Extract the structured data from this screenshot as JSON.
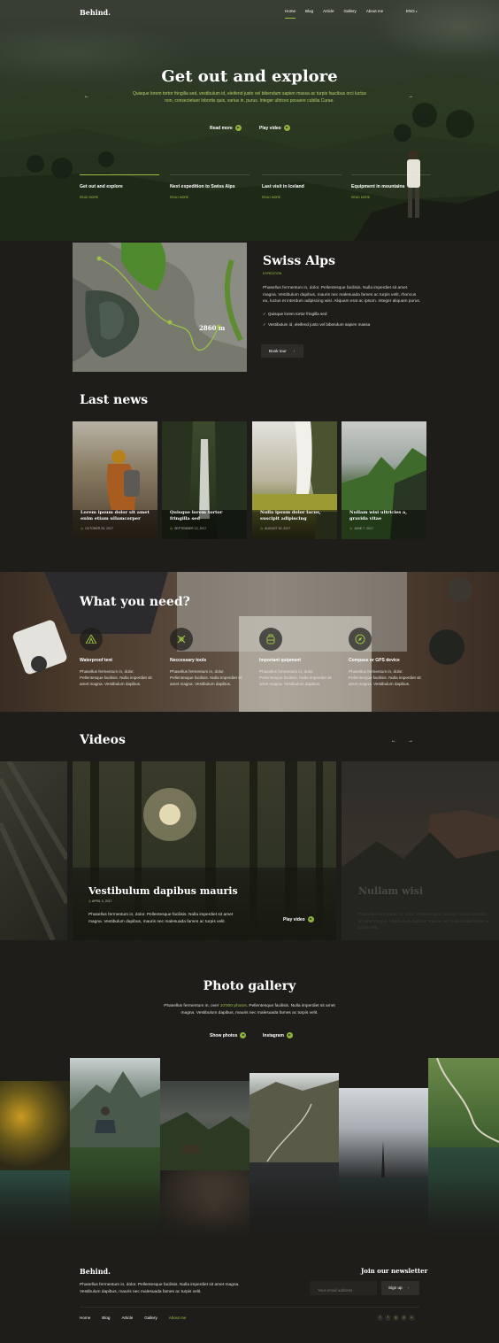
{
  "brand": "Behind.",
  "nav": [
    "Home",
    "Blog",
    "Article",
    "Gallery",
    "About me"
  ],
  "lang": "ENG",
  "hero": {
    "title": "Get out and explore",
    "subtitle": "Quisque lorem tortor fringilla sed, vestibulum id, eleifend justo vel bibendum sapien massa ac turpis faucibus orci luctus non, consectetuer lobortis quis, varius in, purus. Integer ultrices posuere cubilia Curae.",
    "read_more": "Read more",
    "play_video": "Play video",
    "prev_icon": "chevron-left-icon",
    "next_icon": "chevron-right-icon",
    "items": [
      {
        "title": "Get out and explore",
        "link": "READ MORE"
      },
      {
        "title": "Next expedition to Swiss Alps",
        "link": "READ MORE"
      },
      {
        "title": "Last visit in Iceland",
        "link": "READ MORE"
      },
      {
        "title": "Equipment in mountains",
        "link": "READ MORE"
      }
    ]
  },
  "alps": {
    "title": "Swiss Alps",
    "tag": "EXPEDITION",
    "desc": "Phasellus fermentum in, dolor. Pellentesque facilisis. Nulla imperdiet sit amet magna. Vestibulum dapibus, mauris nec malesuada fames ac turpis velit, rhoncus eu, luctus et interdum adipiscing wisi. Aliquam erat ac ipsum. Integer aliquam purus.",
    "checks": [
      "Quisque lorem tortor fringilla sed",
      "Vestibulum id, eleifend justo vel bibendum sapien massa"
    ],
    "altitude": "2860 m",
    "book": "Book tour"
  },
  "news": {
    "title": "Last news",
    "cards": [
      {
        "title": "Lorem ipsum dolor sit amet enim etiam ullamcorper",
        "date": "OCTOBER 25, 2017"
      },
      {
        "title": "Quisque lorem tortor fringilla sed",
        "date": "SEPTEMBER 12, 2017"
      },
      {
        "title": "Nulla ipsum dolor lacus, suscipit adipiscing",
        "date": "AUGUST 30, 2017"
      },
      {
        "title": "Nullam wisi ultricies a, gravida vitae",
        "date": "JUNE 7, 2017"
      }
    ]
  },
  "need": {
    "title": "What you need?",
    "items": [
      {
        "icon": "tent-icon",
        "title": "Waterproof tent",
        "text": "Phasellus fermentum in, dolor. Pellentesque facilisis. Nulla imperdiet sit amet magna. Vestibulum dapibus."
      },
      {
        "icon": "tools-icon",
        "title": "Neccessary tools",
        "text": "Phasellus fermentum in, dolor. Pellentesque facilisis. Nulla imperdiet sit amet magna. Vestibulum dapibus."
      },
      {
        "icon": "backpack-icon",
        "title": "Important quipment",
        "text": "Phasellus fermentum in, dolor. Pellentesque facilisis. Nulla imperdiet sit amet magna. Vestibulum dapibus."
      },
      {
        "icon": "compass-icon",
        "title": "Compass or GPS device",
        "text": "Phasellus fermentum in, dolor. Pellentesque facilisis. Nulla imperdiet sit amet magna. Vestibulum dapibus."
      }
    ]
  },
  "videos": {
    "title": "Videos",
    "main": {
      "title": "Vestibulum dapibus mauris",
      "date": "APRIL 3, 2017",
      "desc": "Phasellus fermentum in, dolor. Pellentesque facilisis. Nulla imperdiet sit amet magna. Vestibulum dapibus, mauris nec malesuada fames ac turpis velit.",
      "play": "Play video"
    },
    "next": {
      "title": "Nullam wisi",
      "desc": "Phasellus fermentum in, dolor. Pellentesque facilisis. Nulla imperdiet sit amet magna. Vestibulum dapibus, mauris nec malesuada fames ac turpis velit."
    }
  },
  "gallery": {
    "title": "Photo gallery",
    "desc_pre": "Phasellus fermentum in, over",
    "desc_highlight": "10'000 photos",
    "desc_post": ". Pellentesque facilisis. Nulla imperdiet sit amet magna. Vestibulum dapibus, mauris nec malesuada fames ac turpis velit.",
    "show_photos": "Show photos",
    "instagram": "Instagram"
  },
  "footer": {
    "brand": "Behind.",
    "desc": "Phasellus fermentum in, dolor. Pellentesque facilisis. Nulla imperdiet sit amet magna. Vestibulum dapibus, mauris nec malesuada fames ac turpis velit.",
    "newsletter_title": "Join our newsletter",
    "email_placeholder": "Your email address",
    "signup": "Sign up",
    "nav": [
      "Home",
      "Blog",
      "Article",
      "Gallery",
      "About me"
    ],
    "social": [
      "twitter-icon",
      "facebook-icon",
      "google-plus-icon",
      "instagram-icon",
      "youtube-icon"
    ]
  },
  "colors": {
    "accent": "#9bc043",
    "background": "#1e1d1a"
  }
}
